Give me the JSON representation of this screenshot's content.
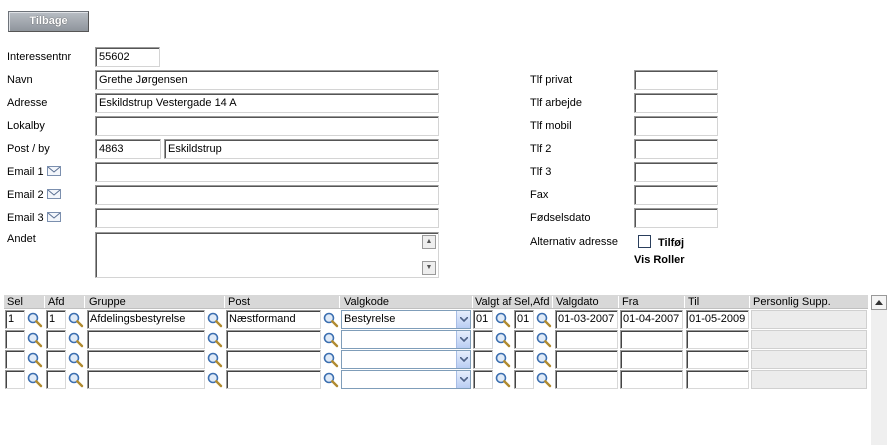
{
  "back_button": "Tilbage",
  "form": {
    "interessentnr": {
      "label": "Interessentnr",
      "value": "55602"
    },
    "navn": {
      "label": "Navn",
      "value": "Grethe Jørgensen"
    },
    "adresse": {
      "label": "Adresse",
      "value": "Eskildstrup Vestergade 14 A"
    },
    "lokalby": {
      "label": "Lokalby",
      "value": ""
    },
    "post_by": {
      "label": "Post / by",
      "postnr": "4863",
      "by": "Eskildstrup"
    },
    "email1": {
      "label": "Email 1",
      "value": ""
    },
    "email2": {
      "label": "Email 2",
      "value": ""
    },
    "email3": {
      "label": "Email 3",
      "value": ""
    },
    "andet": {
      "label": "Andet",
      "value": ""
    }
  },
  "phones": {
    "tlf_privat": {
      "label": "Tlf privat",
      "value": ""
    },
    "tlf_arbejde": {
      "label": "Tlf arbejde",
      "value": ""
    },
    "tlf_mobil": {
      "label": "Tlf mobil",
      "value": ""
    },
    "tlf2": {
      "label": "Tlf 2",
      "value": ""
    },
    "tlf3": {
      "label": "Tlf 3",
      "value": ""
    },
    "fax": {
      "label": "Fax",
      "value": ""
    },
    "fodselsdato": {
      "label": "Fødselsdato",
      "value": ""
    }
  },
  "alt_address": {
    "label": "Alternativ adresse",
    "checked": false,
    "add_label": "Tilføj"
  },
  "vis_roller": "Vis Roller",
  "grid": {
    "headers": [
      "Sel",
      "Afd",
      "Gruppe",
      "Post",
      "Valgkode",
      "Valgt af",
      "Sel,Afd",
      "Valgdato",
      "Fra",
      "Til",
      "Personlig Supp."
    ],
    "rows": [
      {
        "sel": "1",
        "afd": "1",
        "gruppe": "Afdelingsbestyrelse",
        "post": "Næstformand",
        "valgkode": "Bestyrelse",
        "valgt_af": "01",
        "sel_afd": "01",
        "valgdato": "01-03-2007",
        "fra": "01-04-2007",
        "til": "01-05-2009",
        "supp": ""
      },
      {
        "sel": "",
        "afd": "",
        "gruppe": "",
        "post": "",
        "valgkode": "",
        "valgt_af": "",
        "sel_afd": "",
        "valgdato": "",
        "fra": "",
        "til": "",
        "supp": ""
      },
      {
        "sel": "",
        "afd": "",
        "gruppe": "",
        "post": "",
        "valgkode": "",
        "valgt_af": "",
        "sel_afd": "",
        "valgdato": "",
        "fra": "",
        "til": "",
        "supp": ""
      },
      {
        "sel": "",
        "afd": "",
        "gruppe": "",
        "post": "",
        "valgkode": "",
        "valgt_af": "",
        "sel_afd": "",
        "valgdato": "",
        "fra": "",
        "til": "",
        "supp": ""
      }
    ]
  },
  "icons": {
    "mail": "mail-icon",
    "lookup": "magnifier-icon",
    "dropdown": "chevron-down-icon",
    "scroll_up": "scroll-up-icon",
    "scroll_down": "scroll-down-icon"
  },
  "colors": {
    "button_grey": "#9aa0a7",
    "grid_header": "#d8d8d8",
    "select_border": "#7f9db9"
  }
}
